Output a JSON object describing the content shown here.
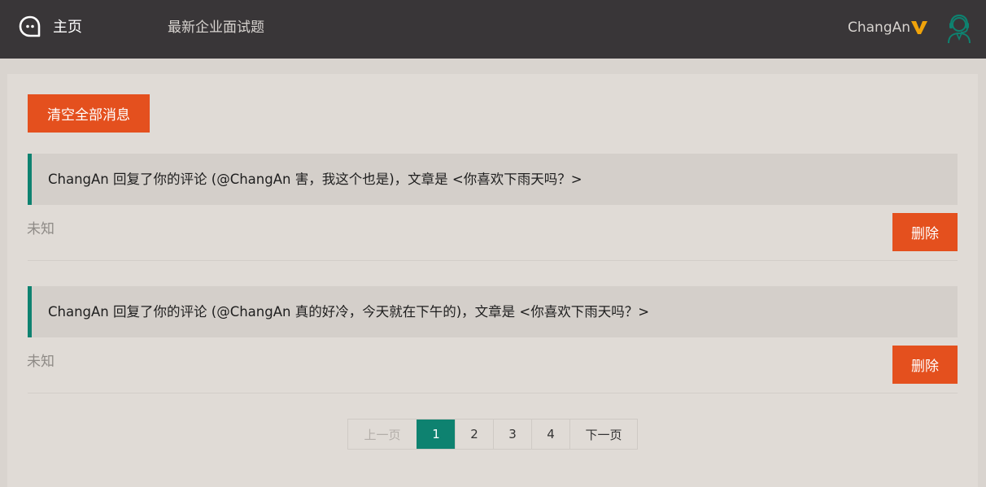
{
  "nav": {
    "home_label": "主页",
    "quiz_label": "最新企业面试题",
    "user_name": "ChangAn"
  },
  "actions": {
    "clear_all_label": "清空全部消息"
  },
  "messages": [
    {
      "text": "ChangAn 回复了你的评论 (@ChangAn 害，我这个也是)，文章是 <你喜欢下雨天吗？>",
      "time": "未知",
      "delete_label": "删除"
    },
    {
      "text": "ChangAn 回复了你的评论 (@ChangAn 真的好冷，今天就在下午的)，文章是 <你喜欢下雨天吗？>",
      "time": "未知",
      "delete_label": "删除"
    }
  ],
  "pagination": {
    "prev_label": "上一页",
    "pages": [
      "1",
      "2",
      "3",
      "4"
    ],
    "current": "1",
    "next_label": "下一页"
  },
  "colors": {
    "topbar": "#393638",
    "accent_orange": "#e4501e",
    "accent_teal": "#0e8270",
    "vip_gold": "#f0a30a"
  },
  "icons": {
    "logo": "chat-bubble-icon",
    "vip": "vip-v-icon",
    "avatar": "customer-service-avatar-icon"
  }
}
